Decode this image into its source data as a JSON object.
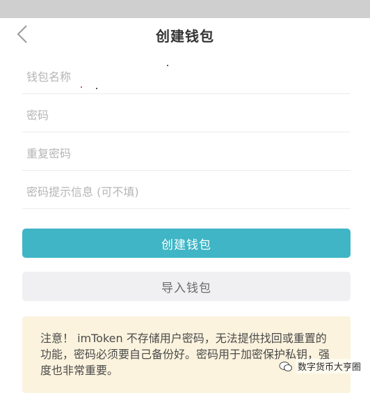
{
  "header": {
    "title": "创建钱包"
  },
  "form": {
    "wallet_name_placeholder": "钱包名称",
    "password_placeholder": "密码",
    "repeat_password_placeholder": "重复密码",
    "hint_placeholder": "密码提示信息 (可不填)"
  },
  "actions": {
    "create_label": "创建钱包",
    "import_label": "导入钱包"
  },
  "notice": {
    "text": "注意！ imToken 不存储用户密码，无法提供找回或重置的功能，密码必须要自己备份好。密码用于加密保护私钥，强度也非常重要。"
  },
  "watermark": {
    "text": "数字货币大亨圈"
  },
  "colors": {
    "primary": "#3fb5c6",
    "secondary": "#f0f0f2",
    "notice_bg": "#fbf3de",
    "status_bar": "#cfcfcf"
  }
}
